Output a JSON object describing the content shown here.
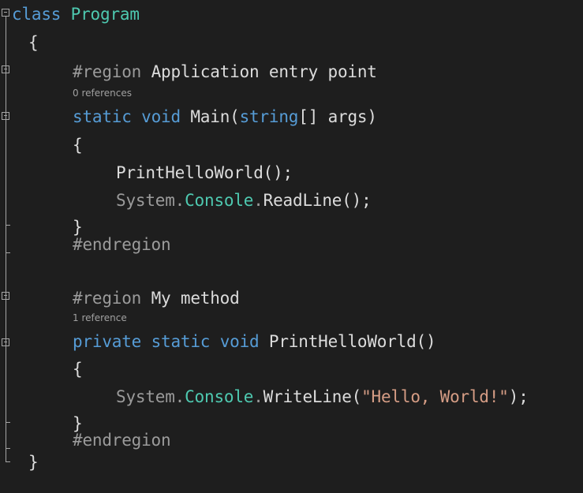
{
  "code": {
    "line1": {
      "keyword": "class",
      "name": "Program"
    },
    "line2": {
      "brace": "{"
    },
    "line3": {
      "keyword": "#region",
      "text": "Application entry point"
    },
    "lens1": "0 references",
    "line4": {
      "kw1": "static",
      "kw2": "void",
      "name": "Main(",
      "type": "string",
      "rest": "[] args)"
    },
    "line5": {
      "brace": "{"
    },
    "line6": {
      "text": "PrintHelloWorld();"
    },
    "line7": {
      "part1": "System.",
      "part2": "Console",
      "part3": ".",
      "part4": "ReadLine();"
    },
    "line8": {
      "brace": "}"
    },
    "line9": {
      "keyword": "#endregion"
    },
    "line10": {
      "keyword": "#region",
      "text": "My method"
    },
    "lens2": "1 reference",
    "line11": {
      "kw1": "private",
      "kw2": "static",
      "kw3": "void",
      "name": "PrintHelloWorld()"
    },
    "line12": {
      "brace": "{"
    },
    "line13": {
      "part1": "System.",
      "part2": "Console",
      "part3": ".",
      "part4": "WriteLine(",
      "str": "\"Hello, World!\"",
      "end": ");"
    },
    "line14": {
      "brace": "}"
    },
    "line15": {
      "keyword": "#endregion"
    },
    "line16": {
      "brace": "}"
    }
  },
  "colors": {
    "background": "#1e1e1e",
    "keyword": "#569cd6",
    "type": "#4ec9b0",
    "identifier": "#dcdcdc",
    "dim": "#9b9b9b",
    "string": "#d69d85",
    "codelens": "#a0a0a0"
  }
}
